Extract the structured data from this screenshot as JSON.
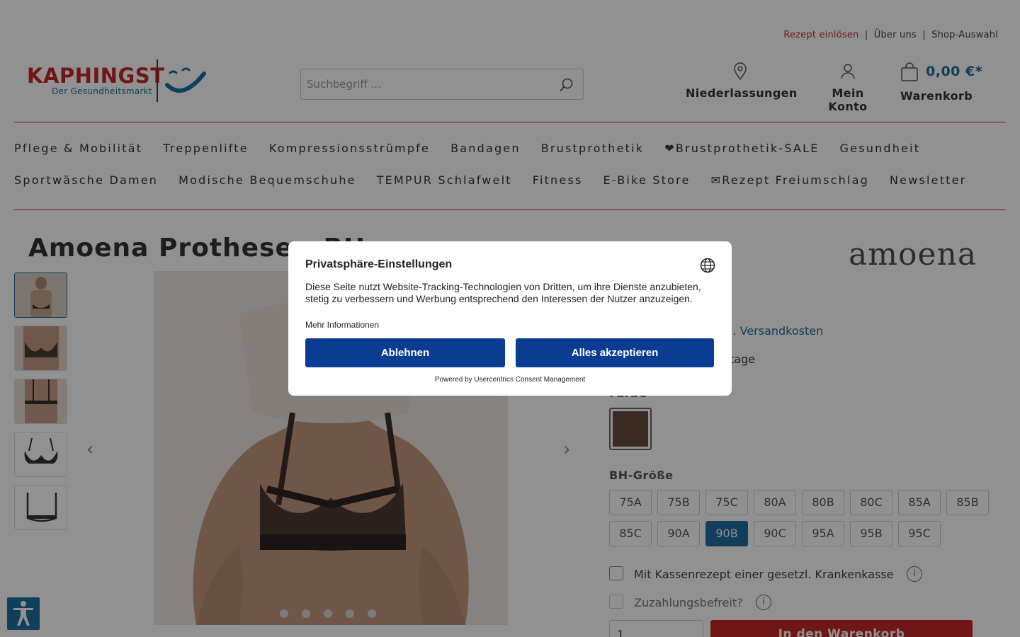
{
  "header": {
    "links": [
      "Rezept einlösen",
      "Über uns",
      "Shop-Auswahl"
    ],
    "separator": "|",
    "logo_text": "KAPHINGST",
    "logo_sub": "Der Gesundheitsmarkt",
    "search_placeholder": "Suchbegriff ...",
    "branches_label": "Niederlassungen",
    "account_label": "Mein Konto",
    "cart_amount": "0,00 €*",
    "cart_label": "Warenkorb"
  },
  "nav": {
    "row1": [
      "Pflege & Mobilität",
      "Treppenlifte",
      "Kompressionsstrümpfe",
      "Bandagen",
      "Brustprothetik",
      "❤Brustprothetik-SALE",
      "Gesundheit"
    ],
    "row2": [
      "Sportwäsche Damen",
      "Modische Bequemschuhe",
      "TEMPUR Schlafwelt",
      "Fitness",
      "E-Bike Store",
      "✉Rezept Freiumschlag",
      "Newsletter"
    ]
  },
  "product": {
    "title": "Amoena Prothesen-BH ...",
    "brand": "amoena",
    "shipping_fragment": "l. Versandkosten",
    "delivery_fragment": "tage",
    "color_label": "Farbe",
    "color_swatch": "#6a4c3f",
    "size_label": "BH-Größe",
    "sizes": [
      "75A",
      "75B",
      "75C",
      "80A",
      "80B",
      "80C",
      "85A",
      "85B",
      "85C",
      "90A",
      "90B",
      "90C",
      "95A",
      "95B",
      "95C"
    ],
    "selected_size": "90B",
    "prescription_label": "Mit Kassenrezept einer gesetzl. Krankenkasse",
    "copay_label": "Zuzahlungsbefreit?",
    "qty_value": "1",
    "add_to_cart": "In den Warenkorb"
  },
  "consent": {
    "title": "Privatsphäre-Einstellungen",
    "text": "Diese Seite nutzt Website-Tracking-Technologien von Dritten, um ihre Dienste anzubieten, stetig zu verbessern und Werbung entsprechend den Interessen der Nutzer anzuzeigen.",
    "more": "Mehr Informationen",
    "decline": "Ablehnen",
    "accept": "Alles akzeptieren",
    "powered": "Powered by Usercentrics Consent Management"
  },
  "colors": {
    "accent_red": "#c62828",
    "accent_blue": "#1e6fa0",
    "consent_button": "#0a3d91"
  }
}
